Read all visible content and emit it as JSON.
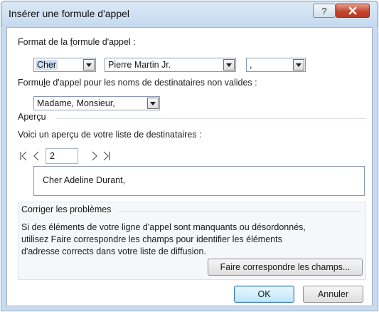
{
  "dialog": {
    "title": "Insérer une formule d'appel",
    "help_glyph": "?",
    "close_glyph": "X"
  },
  "format": {
    "label_pre": "Format de la ",
    "label_u": "f",
    "label_post": "ormule d'appel :",
    "greeting_value": "Cher",
    "name_value": "Pierre Martin Jr.",
    "punct_value": ","
  },
  "invalid": {
    "label_pre": "Formu",
    "label_u": "l",
    "label_post": "e d'appel pour les noms de destinataires non valides :",
    "value": "Madame, Monsieur,"
  },
  "preview": {
    "group_title": "Aperçu",
    "desc": "Voici un aperçu de votre liste de destinataires :",
    "record": "2",
    "text": "Cher Adeline Durant,"
  },
  "fix": {
    "group_title": "Corriger les problèmes",
    "line1": "Si des éléments de votre ligne d'appel sont manquants ou désordonnés,",
    "line2": "utilisez Faire correspondre les champs pour identifier les éléments",
    "line3": "d'adresse corrects dans votre liste de diffusion.",
    "match_label": "Faire correspondre les champs..."
  },
  "buttons": {
    "ok": "OK",
    "cancel": "Annuler"
  },
  "colors": {
    "titlebar": "#c5d9ee",
    "close": "#c44831",
    "selection": "#cfe0f4"
  }
}
